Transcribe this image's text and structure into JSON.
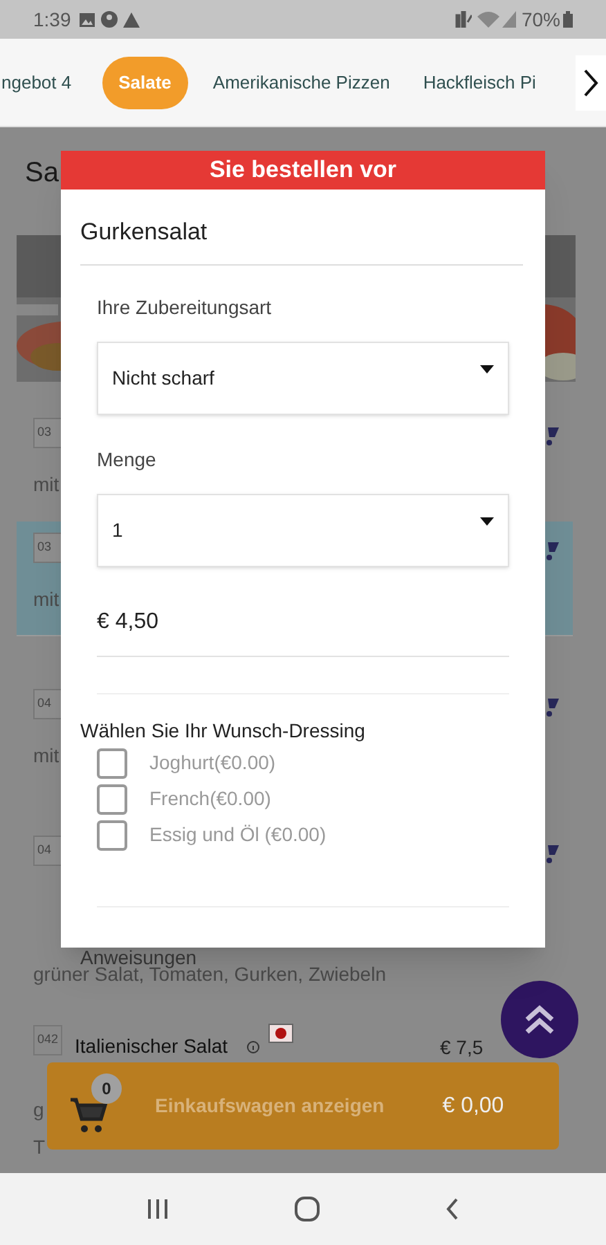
{
  "status_bar": {
    "time": "1:39",
    "battery": "70%"
  },
  "category_tabs": [
    {
      "label": "ngebot 4",
      "selected": false
    },
    {
      "label": "Salate",
      "selected": true
    },
    {
      "label": "Amerikanische Pizzen",
      "selected": false
    },
    {
      "label": "Hackfleisch Pi",
      "selected": false
    }
  ],
  "background": {
    "heading": "Sa",
    "items": [
      {
        "code": "03",
        "description": "mit",
        "highlighted": false
      },
      {
        "code": "03",
        "description": "mit",
        "highlighted": true
      },
      {
        "code": "04",
        "description": "mit",
        "highlighted": false
      },
      {
        "code": "04",
        "description": "grüner Salat, Tomaten, Gurken, Zwiebeln",
        "highlighted": false
      }
    ],
    "last_item": {
      "code": "042",
      "name": "Italienischer Salat",
      "price": "€ 7,5",
      "description_lines": [
        "g",
        "T"
      ]
    }
  },
  "dialog": {
    "header": "Sie bestellen vor",
    "title": "Gurkensalat",
    "selects": [
      {
        "label": "Ihre Zubereitungsart",
        "value": "Nicht scharf"
      },
      {
        "label": "Menge",
        "value": "1"
      }
    ],
    "price": "€ 4,50",
    "dressing": {
      "heading": "Wählen Sie Ihr Wunsch-Dressing",
      "options": [
        {
          "label": "Joghurt(€0.00)",
          "checked": false
        },
        {
          "label": "French(€0.00)",
          "checked": false
        },
        {
          "label": "Essig und Öl (€0.00)",
          "checked": false
        }
      ]
    },
    "instructions_label": "Anweisungen"
  },
  "cart_bar": {
    "count": "0",
    "label": "Einkaufswagen anzeigen",
    "total": "€ 0,00"
  }
}
